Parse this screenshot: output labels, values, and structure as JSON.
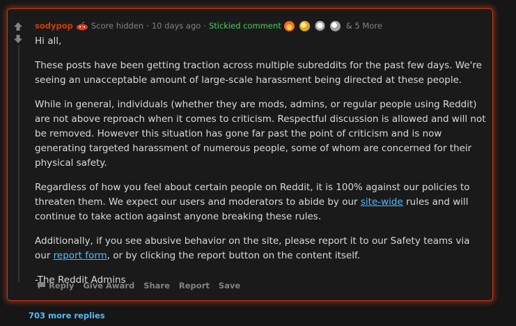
{
  "comment": {
    "username": "sodypop",
    "score": "Score hidden",
    "age": "10 days ago",
    "stickied": "Stickied comment",
    "more_awards": "& 5 More",
    "greeting": "Hi all,",
    "paragraph_1": "These posts have been getting traction across multiple subreddits for the past few days. We're seeing an unacceptable amount of large-scale harassment being directed at these people.",
    "paragraph_2": "While in general, individuals (whether they are mods, admins, or regular people using Reddit) are not above reproach when it comes to criticism. Respectful discussion is allowed and will not be removed. However this situation has gone far past the point of criticism and is now generating targeted harassment of numerous people, some of whom are concerned for their physical safety.",
    "paragraph_3_before": "Regardless of how you feel about certain people on Reddit, it is 100% against our policies to threaten them. We expect our users and moderators to abide by our ",
    "paragraph_3_link": "site-wide",
    "paragraph_3_after": " rules and will continue to take action against anyone breaking these rules.",
    "paragraph_4_before": "Additionally, if you see abusive behavior on the site, please report it to our Safety teams via our ",
    "paragraph_4_link": "report form",
    "paragraph_4_after": ", or by clicking the report button on the content itself.",
    "signature": "-The Reddit Admins"
  },
  "actions": {
    "reply": "Reply",
    "give_award": "Give Award",
    "share": "Share",
    "report": "Report",
    "save": "Save"
  },
  "more_replies": "703 more replies",
  "icons": {
    "upvote": "upvote-arrow-icon",
    "downvote": "downvote-arrow-icon",
    "flair": "snoo-avatar-icon",
    "reply": "speech-bubble-icon"
  },
  "colors": {
    "username": "#d93a00",
    "stickied": "#46d160",
    "link": "#4fbcff",
    "highlight_border": "#c0391b"
  }
}
